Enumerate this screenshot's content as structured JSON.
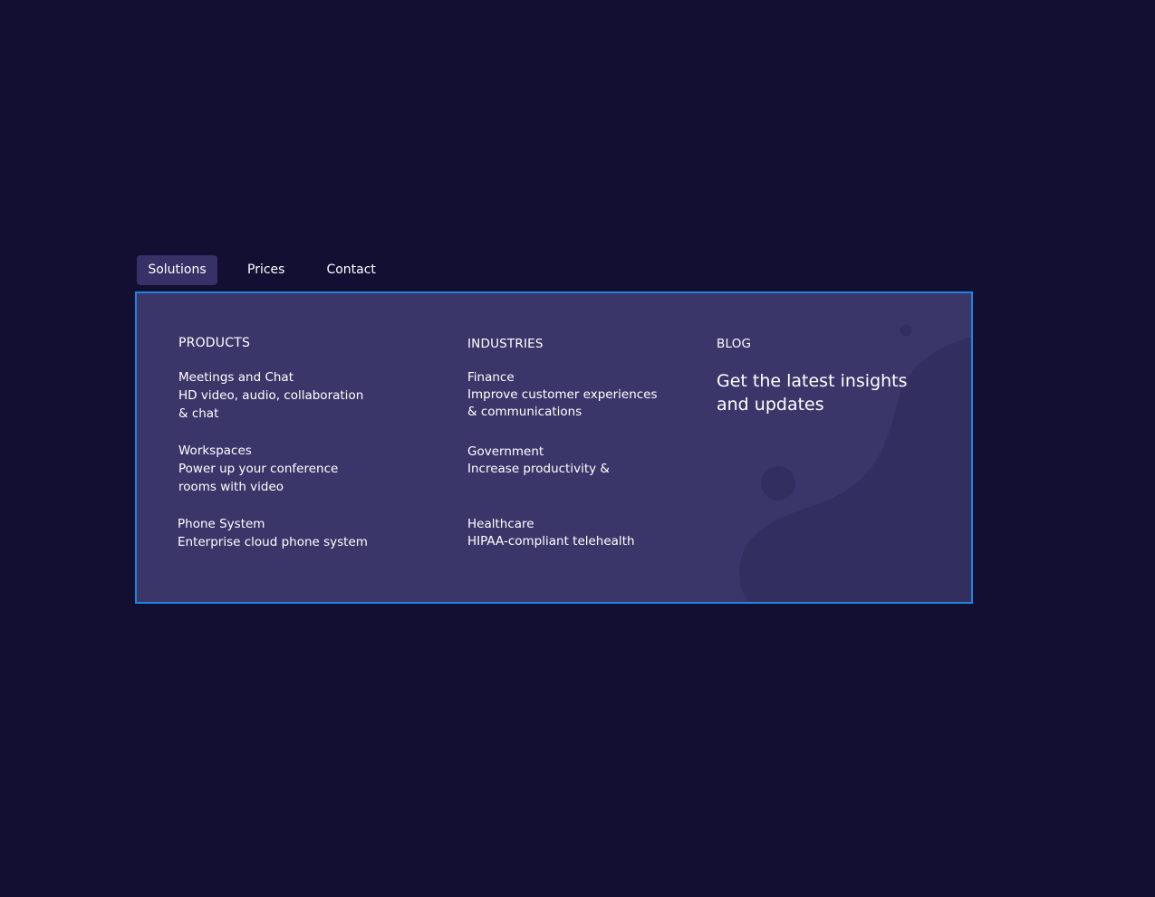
{
  "nav": {
    "items": [
      {
        "label": "Solutions"
      },
      {
        "label": "Prices"
      },
      {
        "label": "Contact"
      }
    ]
  },
  "menu": {
    "products": {
      "title": "PRODUCTS",
      "items": [
        {
          "title": "Meetings and Chat",
          "desc_line1": "HD video, audio, collaboration",
          "desc_line2": "& chat"
        },
        {
          "title": "Workspaces",
          "desc_line1": "Power up your conference",
          "desc_line2": "rooms with video"
        },
        {
          "title": "Phone System",
          "desc_line1": "Enterprise cloud phone system"
        }
      ]
    },
    "industries": {
      "title": "INDUSTRIES",
      "items": [
        {
          "title": "Finance",
          "desc_line1": "Improve customer experiences",
          "desc_line2": "& communications"
        },
        {
          "title": "Government",
          "desc_line1": "Increase productivity &"
        },
        {
          "title": "Healthcare",
          "desc_line1": "HIPAA-compliant telehealth"
        }
      ]
    },
    "blog": {
      "title": "BLOG",
      "headline_line1": "Get the latest insights",
      "headline_line2": "and updates"
    }
  },
  "colors": {
    "page_background": "#120f33",
    "panel_background": "#3b3669",
    "panel_border": "#1f86e0",
    "active_tab": "#363166",
    "decoration": "#332e60"
  }
}
